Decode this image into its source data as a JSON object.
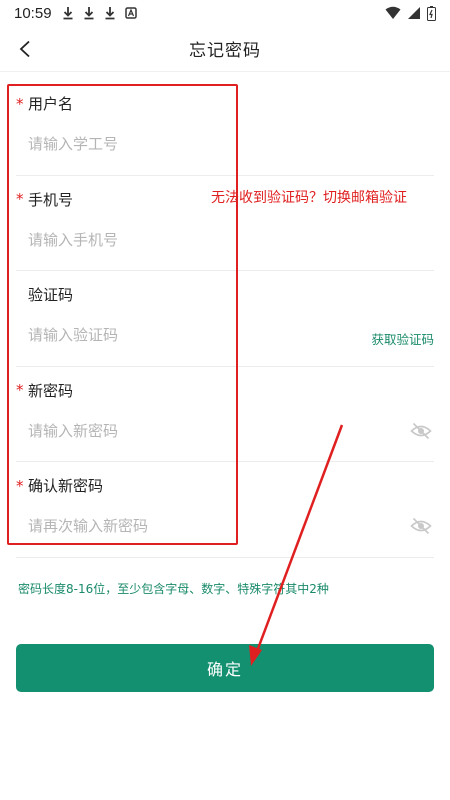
{
  "status_bar": {
    "time": "10:59",
    "left_icons": [
      "download-icon",
      "download-icon",
      "download-icon",
      "a-icon"
    ],
    "right_icons": [
      "wifi-icon",
      "signal-icon",
      "battery-icon"
    ]
  },
  "header": {
    "title": "忘记密码",
    "back_icon": "chevron-left-icon"
  },
  "form": {
    "username": {
      "label": "用户名",
      "required_mark": "*",
      "placeholder": "请输入学工号",
      "value": ""
    },
    "phone": {
      "label": "手机号",
      "required_mark": "*",
      "placeholder": "请输入手机号",
      "value": ""
    },
    "code": {
      "label": "验证码",
      "placeholder": "请输入验证码",
      "value": "",
      "get_code_label": "获取验证码"
    },
    "new_password": {
      "label": "新密码",
      "required_mark": "*",
      "placeholder": "请输入新密码",
      "value": ""
    },
    "confirm_password": {
      "label": "确认新密码",
      "required_mark": "*",
      "placeholder": "请再次输入新密码",
      "value": ""
    }
  },
  "hint": "密码长度8-16位，至少包含字母、数字、特殊字符其中2种",
  "confirm_button": "确定",
  "annotation": {
    "text": "无法收到验证码？切换邮箱验证"
  },
  "colors": {
    "accent": "#129070",
    "link": "#1a8a6a",
    "required": "#e02020",
    "annotation": "#e02020",
    "placeholder": "#b5b5b5"
  }
}
